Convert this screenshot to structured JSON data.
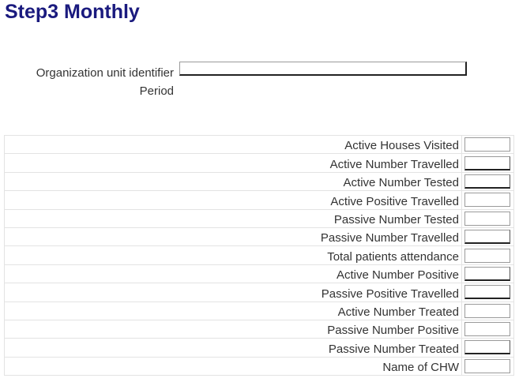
{
  "page": {
    "title": "Step3 Monthly"
  },
  "meta": {
    "org_unit_label": "Organization unit identifier",
    "org_unit_value": "",
    "period_label": "Period"
  },
  "rows": [
    {
      "label": "Active Houses Visited",
      "value": ""
    },
    {
      "label": "Active Number Travelled",
      "value": ""
    },
    {
      "label": "Active Number Tested",
      "value": ""
    },
    {
      "label": "Active Positive Travelled",
      "value": ""
    },
    {
      "label": "Passive Number Tested",
      "value": ""
    },
    {
      "label": "Passive Number Travelled",
      "value": ""
    },
    {
      "label": "Total patients attendance",
      "value": ""
    },
    {
      "label": "Active Number Positive",
      "value": ""
    },
    {
      "label": "Passive Positive Travelled",
      "value": ""
    },
    {
      "label": "Active Number Treated",
      "value": ""
    },
    {
      "label": "Passive Number Positive",
      "value": ""
    },
    {
      "label": "Passive Number Treated",
      "value": ""
    },
    {
      "label": "Name of CHW",
      "value": ""
    }
  ],
  "colors": {
    "title": "#1a1a7e",
    "text": "#333333",
    "grid": "#e3e3e3"
  }
}
